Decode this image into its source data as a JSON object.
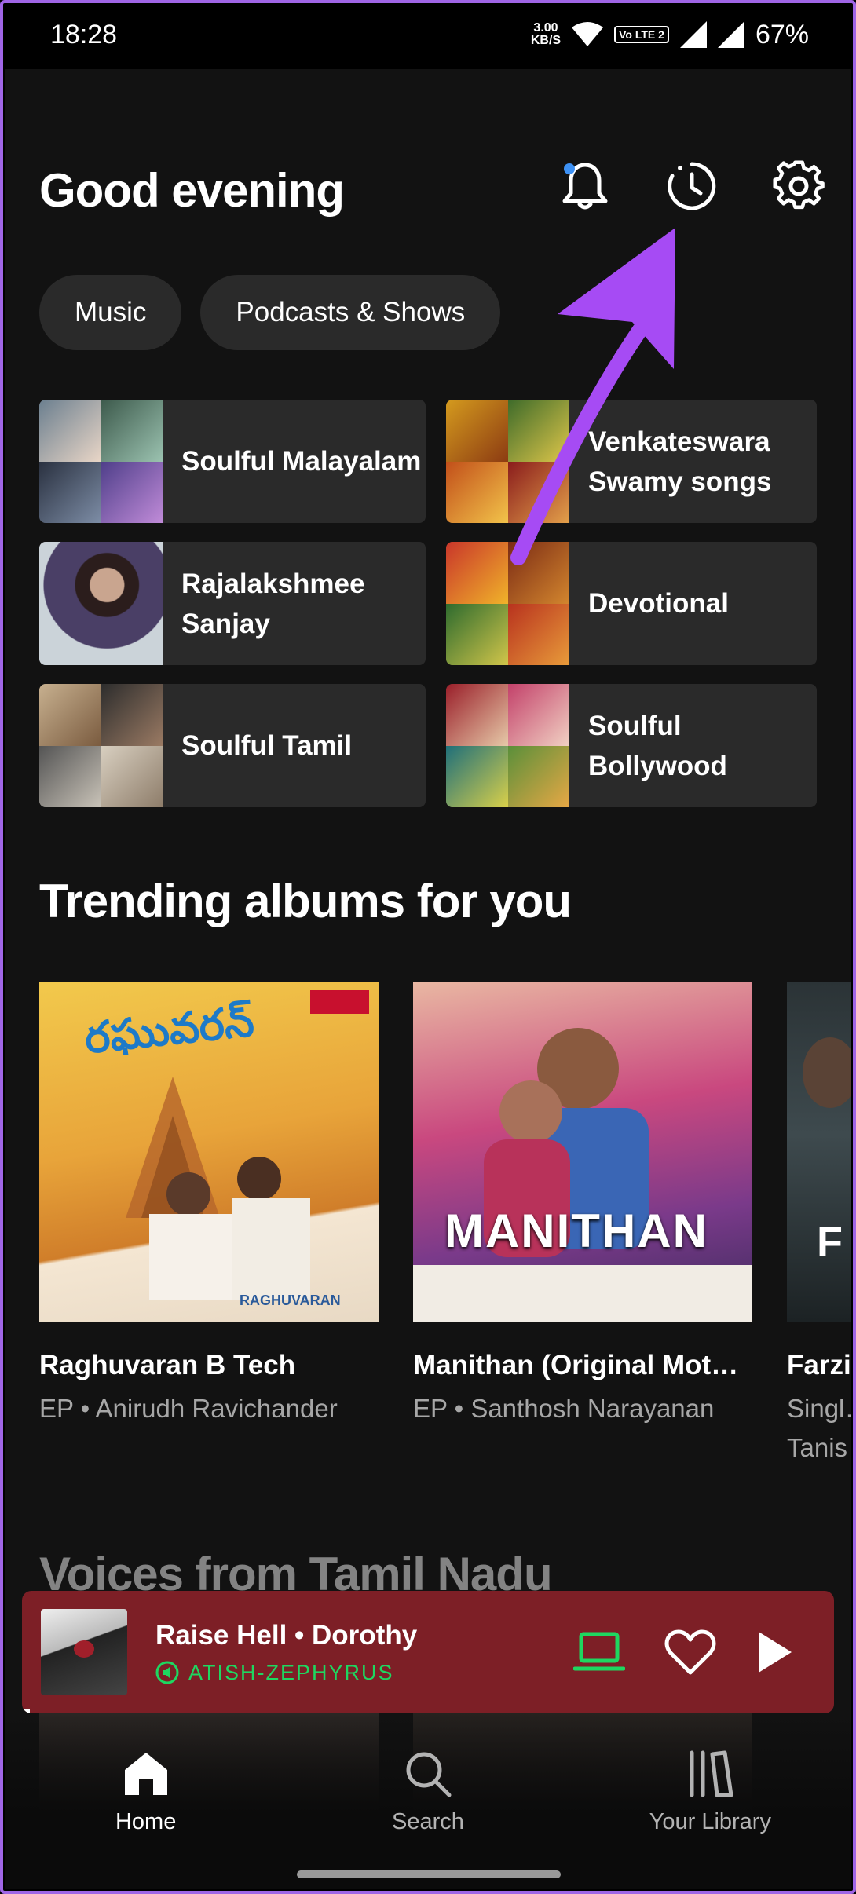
{
  "status_bar": {
    "time": "18:28",
    "net_speed_value": "3.00",
    "net_speed_unit": "KB/S",
    "lte_label": "Vo LTE 2",
    "battery": "67%"
  },
  "header": {
    "greeting": "Good evening",
    "icons": [
      "bell-icon",
      "history-clock-icon",
      "gear-icon"
    ]
  },
  "chips": [
    "Music",
    "Podcasts & Shows"
  ],
  "shortcuts": [
    {
      "label": "Soulful Malayalam"
    },
    {
      "label": "Venkateswara Swamy songs"
    },
    {
      "label": "Rajalakshmee Sanjay"
    },
    {
      "label": "Devotional"
    },
    {
      "label": "Soulful Tamil"
    },
    {
      "label": "Soulful Bollywood"
    }
  ],
  "trending": {
    "title": "Trending albums for you",
    "albums": [
      {
        "title": "Raghuvaran B Tech",
        "subtitle": "EP • Anirudh Ravichander",
        "art_text": "RAGHUVARAN",
        "accent": "#e7a92c"
      },
      {
        "title": "Manithan (Original Mot…",
        "subtitle": "EP • Santhosh Narayanan",
        "art_text": "MANITHAN",
        "accent": "#c9487f"
      },
      {
        "title": "Farzi",
        "subtitle": "Singl… Tanis…",
        "art_text": "F",
        "accent": "#2f3a3e"
      }
    ]
  },
  "voices": {
    "title": "Voices from Tamil Nadu"
  },
  "mini_player": {
    "track": "Raise Hell • Dorothy",
    "device": "ATISH-ZEPHYRUS",
    "progress_fraction": 0.01,
    "background": "#7d1f26"
  },
  "nav": [
    {
      "label": "Home",
      "icon": "home-icon",
      "active": true
    },
    {
      "label": "Search",
      "icon": "search-icon",
      "active": false
    },
    {
      "label": "Your Library",
      "icon": "library-icon",
      "active": false
    }
  ],
  "colors": {
    "spotify_green": "#1ed760",
    "annotation_arrow": "#a64bf4"
  }
}
